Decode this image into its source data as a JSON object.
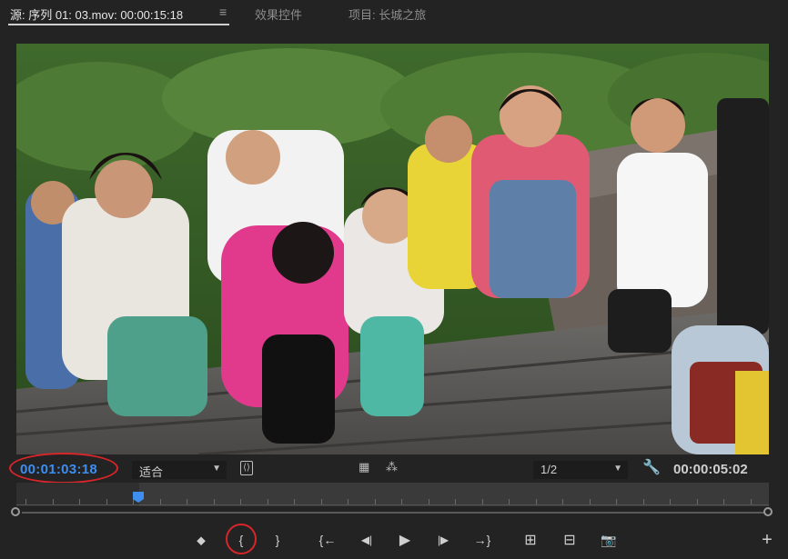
{
  "tabs": {
    "source_label": "源: 序列 01: 03.mov: 00:00:15:18",
    "menu_glyph": "≡",
    "effects_label": "效果控件",
    "project_label": "项目: 长城之旅"
  },
  "controls": {
    "current_timecode": "00:01:03:18",
    "zoom_value": "适合",
    "resolution_value": "1/2",
    "duration_timecode": "00:00:05:02"
  },
  "transport": {
    "add_marker": "⬥",
    "mark_in": "{",
    "mark_out": "}",
    "go_to_in": "{←",
    "step_back": "◀|",
    "play": "▶",
    "step_forward": "|▶",
    "go_to_out": "→}",
    "insert": "⊞",
    "overwrite": "⊟",
    "export_frame": "📷",
    "add": "+"
  },
  "colors": {
    "timecode_blue": "#3d8ef0",
    "annotation_red": "#d6262a"
  }
}
